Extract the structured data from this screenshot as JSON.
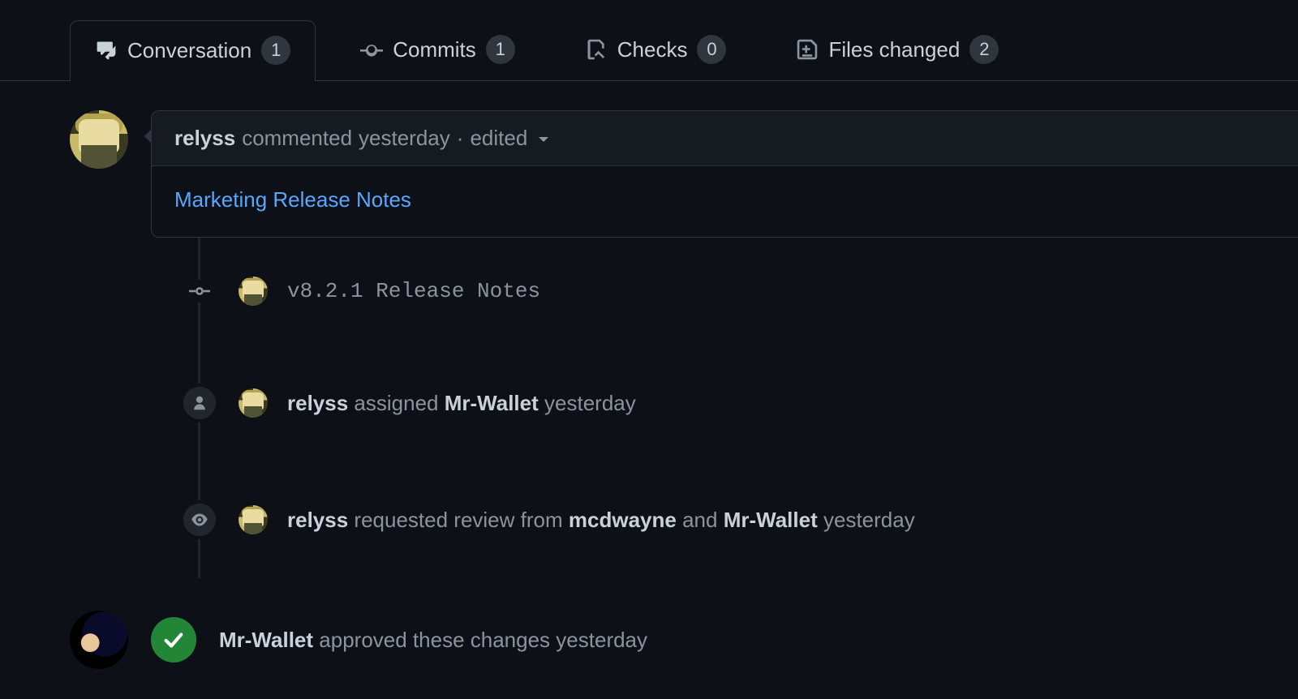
{
  "tabs": {
    "conversation": {
      "label": "Conversation",
      "count": "1"
    },
    "commits": {
      "label": "Commits",
      "count": "1"
    },
    "checks": {
      "label": "Checks",
      "count": "0"
    },
    "files": {
      "label": "Files changed",
      "count": "2"
    }
  },
  "comment": {
    "author": "relyss",
    "action": "commented",
    "time": "yesterday",
    "edited_label": "edited",
    "body_link": "Marketing Release Notes"
  },
  "timeline": {
    "commit": {
      "message": "v8.2.1 Release Notes"
    },
    "assign": {
      "actor": "relyss",
      "verb": "assigned",
      "assignee": "Mr-Wallet",
      "time": "yesterday"
    },
    "review_request": {
      "actor": "relyss",
      "verb": "requested review from",
      "reviewer1": "mcdwayne",
      "and": "and",
      "reviewer2": "Mr-Wallet",
      "time": "yesterday"
    },
    "approval": {
      "actor": "Mr-Wallet",
      "verb": "approved these changes",
      "time": "yesterday"
    }
  }
}
